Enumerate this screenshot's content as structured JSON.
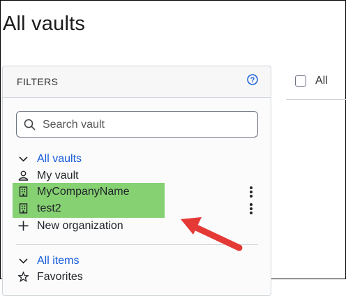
{
  "page": {
    "title": "All vaults"
  },
  "filters": {
    "title": "FILTERS",
    "search_placeholder": "Search vault",
    "vaults": {
      "header": "All vaults",
      "items": [
        {
          "label": "My vault",
          "icon": "person-icon"
        },
        {
          "label": "MyCompanyName",
          "icon": "building-icon",
          "highlighted": true
        },
        {
          "label": "test2",
          "icon": "building-icon",
          "highlighted": true
        },
        {
          "label": "New organization",
          "icon": "plus-icon"
        }
      ]
    },
    "items_section": {
      "header": "All items",
      "items": [
        {
          "label": "Favorites",
          "icon": "star-icon"
        }
      ]
    }
  },
  "list": {
    "select_all_label": "All"
  },
  "colors": {
    "accent": "#175ddc",
    "highlight": "#86d172",
    "arrow": "#e53935"
  }
}
